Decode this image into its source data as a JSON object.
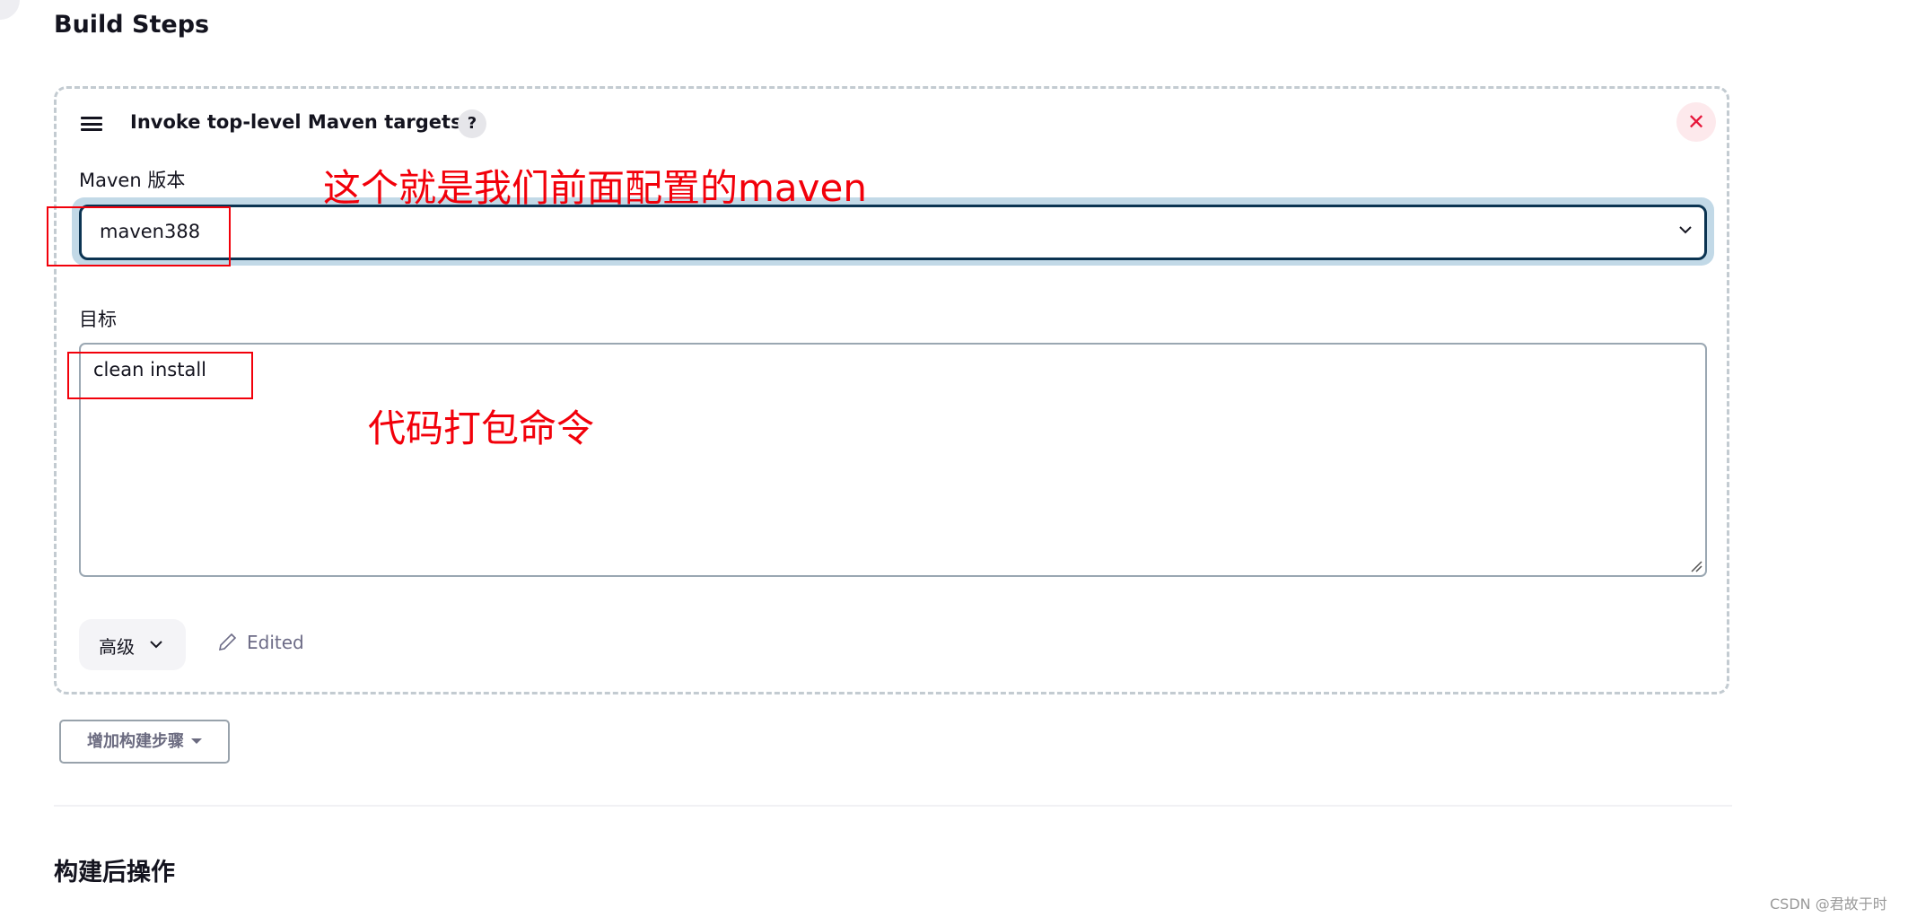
{
  "sections": {
    "build_steps_title": "Build Steps",
    "post_build_title": "构建后操作"
  },
  "step": {
    "title": "Invoke top-level Maven targets",
    "help_label": "?",
    "close_icon": "close-icon",
    "maven_version_label": "Maven 版本",
    "maven_version_value": "maven388",
    "goals_label": "目标",
    "goals_value": "clean install",
    "advanced_label": "高级",
    "edited_label": "Edited"
  },
  "add_step_button": "增加构建步骤",
  "annotations": {
    "maven_note": "这个就是我们前面配置的maven",
    "goals_note": "代码打包命令",
    "color": "#f2000a"
  },
  "watermark": "CSDN @君故于时",
  "colors": {
    "focus_ring": "#c2d9e7",
    "select_border": "#0b3452",
    "close_bg": "#fde9ec",
    "close_fg": "#e6163a"
  }
}
